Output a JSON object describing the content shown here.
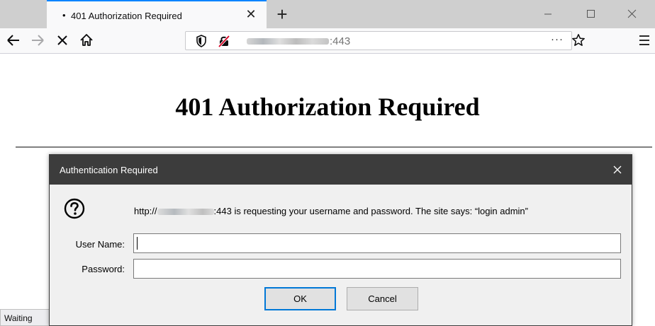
{
  "browser": {
    "tab": {
      "title": "401 Authorization Required",
      "dot": "•"
    },
    "address": {
      "port_suffix": ":443",
      "page_actions": "···"
    }
  },
  "page": {
    "heading": "401 Authorization Required",
    "status_text": "Waiting"
  },
  "dialog": {
    "title": "Authentication Required",
    "message_prefix": "http://",
    "message_suffix": ":443 is requesting your username and password. The site says: “login admin”",
    "username_label": "User Name:",
    "password_label": "Password:",
    "username_value": "",
    "password_value": "",
    "ok_label": "OK",
    "cancel_label": "Cancel"
  },
  "colors": {
    "accent": "#0a84ff",
    "dialog_titlebar": "#3c3c3c",
    "tabstrip": "#cfcfcf",
    "ok_focus": "#0078d7"
  }
}
